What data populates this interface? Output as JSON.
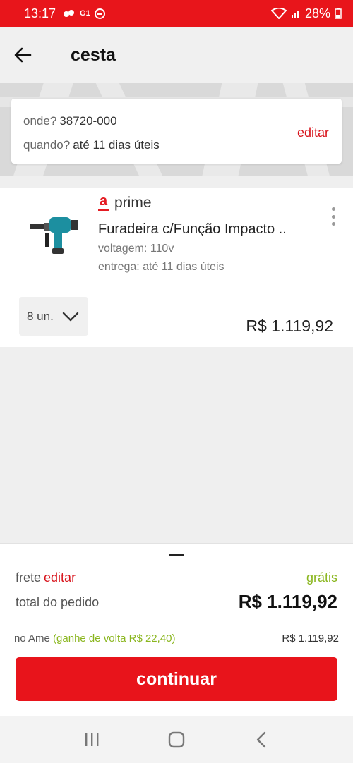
{
  "status_bar": {
    "time": "13:17",
    "badge": "G1",
    "battery": "28%"
  },
  "header": {
    "title": "cesta"
  },
  "address": {
    "where_label": "onde?",
    "where_value": "38720-000",
    "when_label": "quando?",
    "when_value": "até 11 dias úteis",
    "edit_label": "editar"
  },
  "product": {
    "prime_mark": "a",
    "prime_label": "prime",
    "title": "Furadeira c/Função Impacto ..",
    "voltage": "voltagem: 110v",
    "delivery": "entrega: até 11 dias úteis",
    "quantity": "8 un.",
    "price": "R$ 1.119,92"
  },
  "summary": {
    "frete_label": "frete",
    "frete_edit": "editar",
    "frete_value": "grátis",
    "total_label": "total do pedido",
    "total_value": "R$ 1.119,92",
    "ame_label": "no Ame",
    "ame_cashback": "(ganhe de volta R$ 22,40)",
    "ame_value": "R$ 1.119,92",
    "continue_label": "continuar"
  },
  "colors": {
    "brand_red": "#e8151b",
    "cashback_green": "#8ab61e"
  },
  "icons": [
    "back-arrow-icon",
    "kebab-menu-icon",
    "chevron-down-icon",
    "recent-apps-icon",
    "home-icon",
    "nav-back-icon",
    "wifi-icon",
    "signal-icon",
    "battery-icon"
  ]
}
